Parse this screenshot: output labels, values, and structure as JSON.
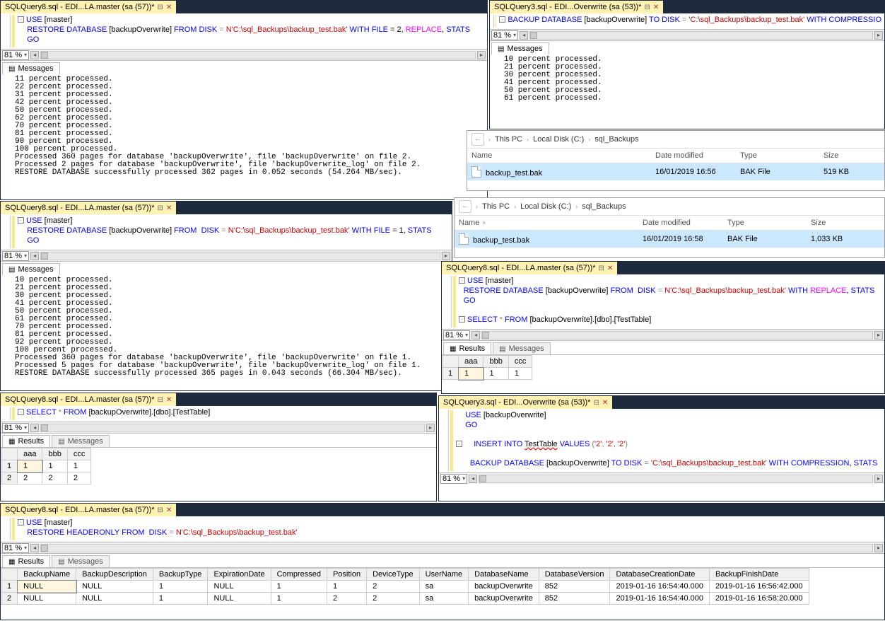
{
  "zoom": "81 %",
  "p1": {
    "tab": "SQLQuery8.sql - EDI...LA.master (sa (57))*",
    "code": {
      "l1p1": "USE",
      "l1p2": " [master]",
      "l2p1": "RESTORE",
      "l2p2": " DATABASE",
      "l2p3": " [backupOverwrite] ",
      "l2p4": "FROM",
      "l2p5": " DISK",
      "l2p6": " = ",
      "l2p7": "N'C:\\sql_Backups\\backup_test.bak'",
      "l2p8": " WITH",
      "l2p9": " FILE",
      "l2p10": " = 2, ",
      "l2p11": "REPLACE",
      "l2p12": ", ",
      "l2p13": "STATS",
      "l3": "GO"
    },
    "msgTab": "Messages",
    "msgs": "11 percent processed.\n22 percent processed.\n31 percent processed.\n42 percent processed.\n50 percent processed.\n62 percent processed.\n70 percent processed.\n81 percent processed.\n90 percent processed.\n100 percent processed.\nProcessed 360 pages for database 'backupOverwrite', file 'backupOverwrite' on file 2.\nProcessed 2 pages for database 'backupOverwrite', file 'backupOverwrite_log' on file 2.\nRESTORE DATABASE successfully processed 362 pages in 0.052 seconds (54.264 MB/sec)."
  },
  "p2": {
    "tab": "SQLQuery8.sql - EDI...LA.master (sa (57))*",
    "code": {
      "l1p1": "USE",
      "l1p2": " [master]",
      "l2p1": "RESTORE",
      "l2p2": " DATABASE",
      "l2p3": " [backupOverwrite] ",
      "l2p4": "FROM",
      "l2p5": "  DISK",
      "l2p6": " = ",
      "l2p7": "N'C:\\sql_Backups\\backup_test.bak'",
      "l2p8": " WITH",
      "l2p9": " FILE",
      "l2p10": " = 1, ",
      "l2p11": "STATS",
      "l3": "GO"
    },
    "msgTab": "Messages",
    "msgs": "10 percent processed.\n21 percent processed.\n30 percent processed.\n41 percent processed.\n50 percent processed.\n61 percent processed.\n70 percent processed.\n81 percent processed.\n92 percent processed.\n100 percent processed.\nProcessed 360 pages for database 'backupOverwrite', file 'backupOverwrite' on file 1.\nProcessed 5 pages for database 'backupOverwrite', file 'backupOverwrite_log' on file 1.\nRESTORE DATABASE successfully processed 365 pages in 0.043 seconds (66.304 MB/sec)."
  },
  "p3": {
    "tab": "SQLQuery8.sql - EDI...LA.master (sa (57))*",
    "code": {
      "l1p1": "SELECT",
      "l1p2": " * ",
      "l1p3": "FROM",
      "l1p4": " [backupOverwrite].[dbo].[TestTable]"
    },
    "resTab": "Results",
    "msgTab": "Messages",
    "cols": [
      "aaa",
      "bbb",
      "ccc"
    ],
    "rows": [
      [
        "1",
        "1",
        "1",
        "1"
      ],
      [
        "2",
        "2",
        "2",
        "2"
      ]
    ]
  },
  "p4": {
    "tab": "SQLQuery3.sql - EDI...Overwrite (sa (53))*",
    "code": {
      "l1p1": "BACKUP",
      "l1p2": " DATABASE",
      "l1p3": " [backupOverwrite] ",
      "l1p4": "TO",
      "l1p5": " DISK",
      "l1p6": " = ",
      "l1p7": "'C:\\sql_Backups\\backup_test.bak'",
      "l1p8": " WITH",
      "l1p9": " COMPRESSIO"
    },
    "msgTab": "Messages",
    "msgs": "10 percent processed.\n21 percent processed.\n30 percent processed.\n41 percent processed.\n50 percent processed.\n61 percent processed."
  },
  "exp1": {
    "crumbs": [
      "This PC",
      "Local Disk (C:)",
      "sql_Backups"
    ],
    "cols": [
      "Name",
      "Date modified",
      "Type",
      "Size"
    ],
    "row": {
      "name": "backup_test.bak",
      "date": "16/01/2019 16:56",
      "type": "BAK File",
      "size": "519 KB"
    }
  },
  "exp2": {
    "crumbs": [
      "This PC",
      "Local Disk (C:)",
      "sql_Backups"
    ],
    "cols": [
      "Name",
      "Date modified",
      "Type",
      "Size"
    ],
    "row": {
      "name": "backup_test.bak",
      "date": "16/01/2019 16:58",
      "type": "BAK File",
      "size": "1,033 KB"
    }
  },
  "p5": {
    "tab": "SQLQuery8.sql - EDI...LA.master (sa (57))*",
    "code": {
      "l1p1": "USE",
      "l1p2": " [master]",
      "l2p1": "RESTORE",
      "l2p2": " DATABASE",
      "l2p3": " [backupOverwrite] ",
      "l2p4": "FROM",
      "l2p5": "  DISK",
      "l2p6": " = ",
      "l2p7": "N'C:\\sql_Backups\\backup_test.bak'",
      "l2p8": " WITH",
      "l2p9": " REPLACE",
      "l2p10": ", ",
      "l2p11": "STATS",
      "l3": "GO",
      "l4p1": "SELECT",
      "l4p2": " * ",
      "l4p3": "FROM",
      "l4p4": " [backupOverwrite].[dbo].[TestTable]"
    },
    "resTab": "Results",
    "msgTab": "Messages",
    "cols": [
      "aaa",
      "bbb",
      "ccc"
    ],
    "rows": [
      [
        "1",
        "1",
        "1",
        "1"
      ]
    ]
  },
  "p6": {
    "tab": "SQLQuery3.sql - EDI...Overwrite (sa (53))*",
    "code": {
      "l1p1": "USE",
      "l1p2": " [backupOverwrite]",
      "l2": "GO",
      "l3p1": "INSERT",
      "l3p2": " INTO ",
      "l3p3": "TestTable",
      "l3p4": " VALUES",
      "l3p5": " (",
      "l3p6": "'2'",
      "l3p7": ", ",
      "l3p8": "'2'",
      "l3p9": ", ",
      "l3p10": "'2'",
      "l3p11": ")",
      "l4p1": "BACKUP",
      "l4p2": " DATABASE",
      "l4p3": " [backupOverwrite] ",
      "l4p4": "TO",
      "l4p5": " DISK",
      "l4p6": " = ",
      "l4p7": "'C:\\sql_Backups\\backup_test.bak'",
      "l4p8": " WITH",
      "l4p9": " COMPRESSION",
      "l4p10": ", ",
      "l4p11": "STATS"
    }
  },
  "p7": {
    "tab": "SQLQuery8.sql - EDI...LA.master (sa (57))*",
    "code": {
      "l1p1": "USE",
      "l1p2": " [master]",
      "l2p1": "RESTORE",
      "l2p2": " HEADERONLY ",
      "l2p3": "FROM",
      "l2p4": "  DISK",
      "l2p5": " = ",
      "l2p6": "N'C:\\sql_Backups\\backup_test.bak'"
    },
    "resTab": "Results",
    "msgTab": "Messages",
    "cols": [
      "BackupName",
      "BackupDescription",
      "BackupType",
      "ExpirationDate",
      "Compressed",
      "Position",
      "DeviceType",
      "UserName",
      "DatabaseName",
      "DatabaseVersion",
      "DatabaseCreationDate",
      "BackupFinishDate"
    ],
    "rows": [
      [
        "1",
        "NULL",
        "NULL",
        "1",
        "NULL",
        "1",
        "1",
        "2",
        "sa",
        "backupOverwrite",
        "852",
        "2019-01-16 16:54:40.000",
        "2019-01-16 16:56:42.000"
      ],
      [
        "2",
        "NULL",
        "NULL",
        "1",
        "NULL",
        "1",
        "2",
        "2",
        "sa",
        "backupOverwrite",
        "852",
        "2019-01-16 16:54:40.000",
        "2019-01-16 16:58:20.000"
      ]
    ]
  }
}
